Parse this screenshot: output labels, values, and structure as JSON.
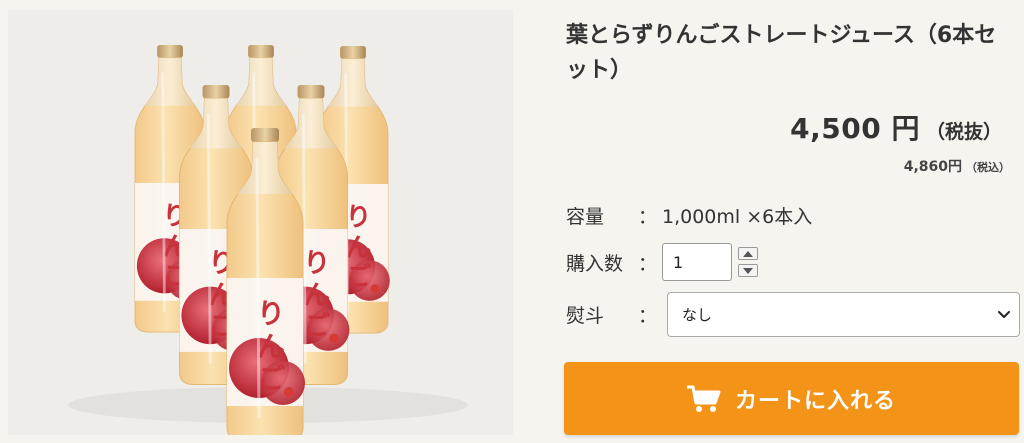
{
  "product": {
    "title": "葉とらずりんごストレートジュース（6本セット）",
    "image_alt": "りんごジュース 6本セット",
    "bottle_label_text": "りんご"
  },
  "price": {
    "main": "4,500 円",
    "main_suffix": "（税抜）",
    "tax_included": "4,860円",
    "tax_included_label": "（税込）"
  },
  "specs": {
    "capacity_label": "容量",
    "capacity_colon": "：",
    "capacity_value": "1,000ml ×6本入",
    "quantity_label": "購入数",
    "quantity_colon": "：",
    "quantity_value": "1",
    "noshi_label": "熨斗",
    "noshi_colon": "：",
    "noshi_selected": "なし"
  },
  "cart": {
    "button_label": "カートに入れる",
    "icon": "cart-icon"
  },
  "colors": {
    "accent": "#f39419",
    "background": "#f6f4ef",
    "juice": "#f6d79a",
    "label_red": "#c8323b"
  }
}
